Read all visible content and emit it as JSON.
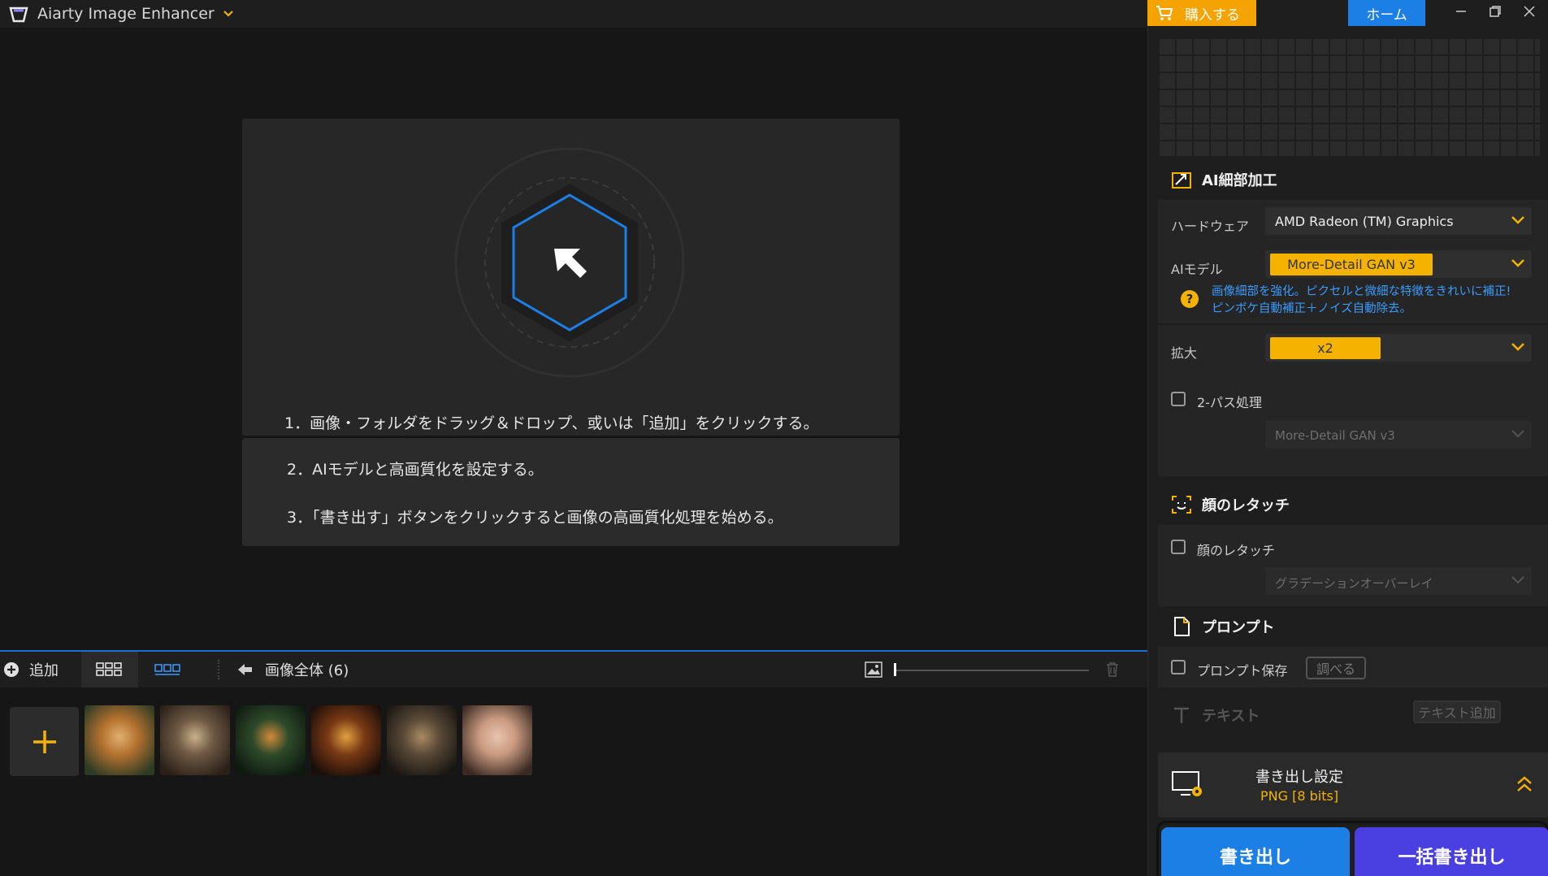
{
  "app": {
    "title": "Aiarty Image Enhancer"
  },
  "window": {
    "buy_label": "購入する",
    "home_label": "ホーム"
  },
  "main": {
    "steps": [
      "1．画像・フォルダをドラッグ＆ドロップ、或いは「追加」をクリックする。",
      "2．AIモデルと高画質化を設定する。",
      "3．「書き出す」ボタンをクリックすると画像の高画質化処理を始める。"
    ]
  },
  "toolbar": {
    "add_label": "追加",
    "all_images_label": "画像全体 (6)"
  },
  "thumbnails": [
    {
      "name": "tiger",
      "colors": [
        "#b5722f",
        "#2e3b24",
        "#e0b070"
      ]
    },
    {
      "name": "butterfly",
      "colors": [
        "#6e5a45",
        "#2b2018",
        "#c9b08a"
      ]
    },
    {
      "name": "terrarium",
      "colors": [
        "#2e4a2a",
        "#0e1a10",
        "#d08a3a"
      ]
    },
    {
      "name": "burger",
      "colors": [
        "#7a3a14",
        "#1a0e0a",
        "#e0a040"
      ]
    },
    {
      "name": "dog",
      "colors": [
        "#5a4a38",
        "#1a1612",
        "#a88a60"
      ]
    },
    {
      "name": "portrait",
      "colors": [
        "#c99a80",
        "#3a2a22",
        "#e8c4b0"
      ]
    }
  ],
  "panel": {
    "ai_section": {
      "title": "AI細部加工",
      "hardware_label": "ハードウェア",
      "hardware_value": "AMD Radeon (TM) Graphics",
      "model_label": "AIモデル",
      "model_value": "More-Detail GAN  v3",
      "hint_line1": "画像細部を強化。ピクセルと微細な特徴をきれいに補正!",
      "hint_line2": "ピンボケ自動補正＋ノイズ自動除去。",
      "scale_label": "拡大",
      "scale_value": "x2",
      "two_pass_label": "2-パス処理",
      "two_pass_model": "More-Detail GAN  v3"
    },
    "face_section": {
      "title": "顔のレタッチ",
      "checkbox_label": "顔のレタッチ",
      "mode_value": "グラデーションオーバーレイ"
    },
    "prompt_section": {
      "title": "プロンプト",
      "checkbox_label": "プロンプト保存",
      "check_button": "調べる"
    },
    "text_section": {
      "title": "テキスト",
      "add_button": "テキスト追加"
    },
    "export_settings": {
      "title": "書き出し設定",
      "format": "PNG   [8 bits]"
    },
    "export_button": "書き出し",
    "batch_export_button": "一括書き出し"
  },
  "colors": {
    "accent_blue": "#1c7fe6",
    "accent_yellow": "#f5b300",
    "buy_orange": "#f5a300",
    "batch_purple": "#4a3fe0"
  }
}
